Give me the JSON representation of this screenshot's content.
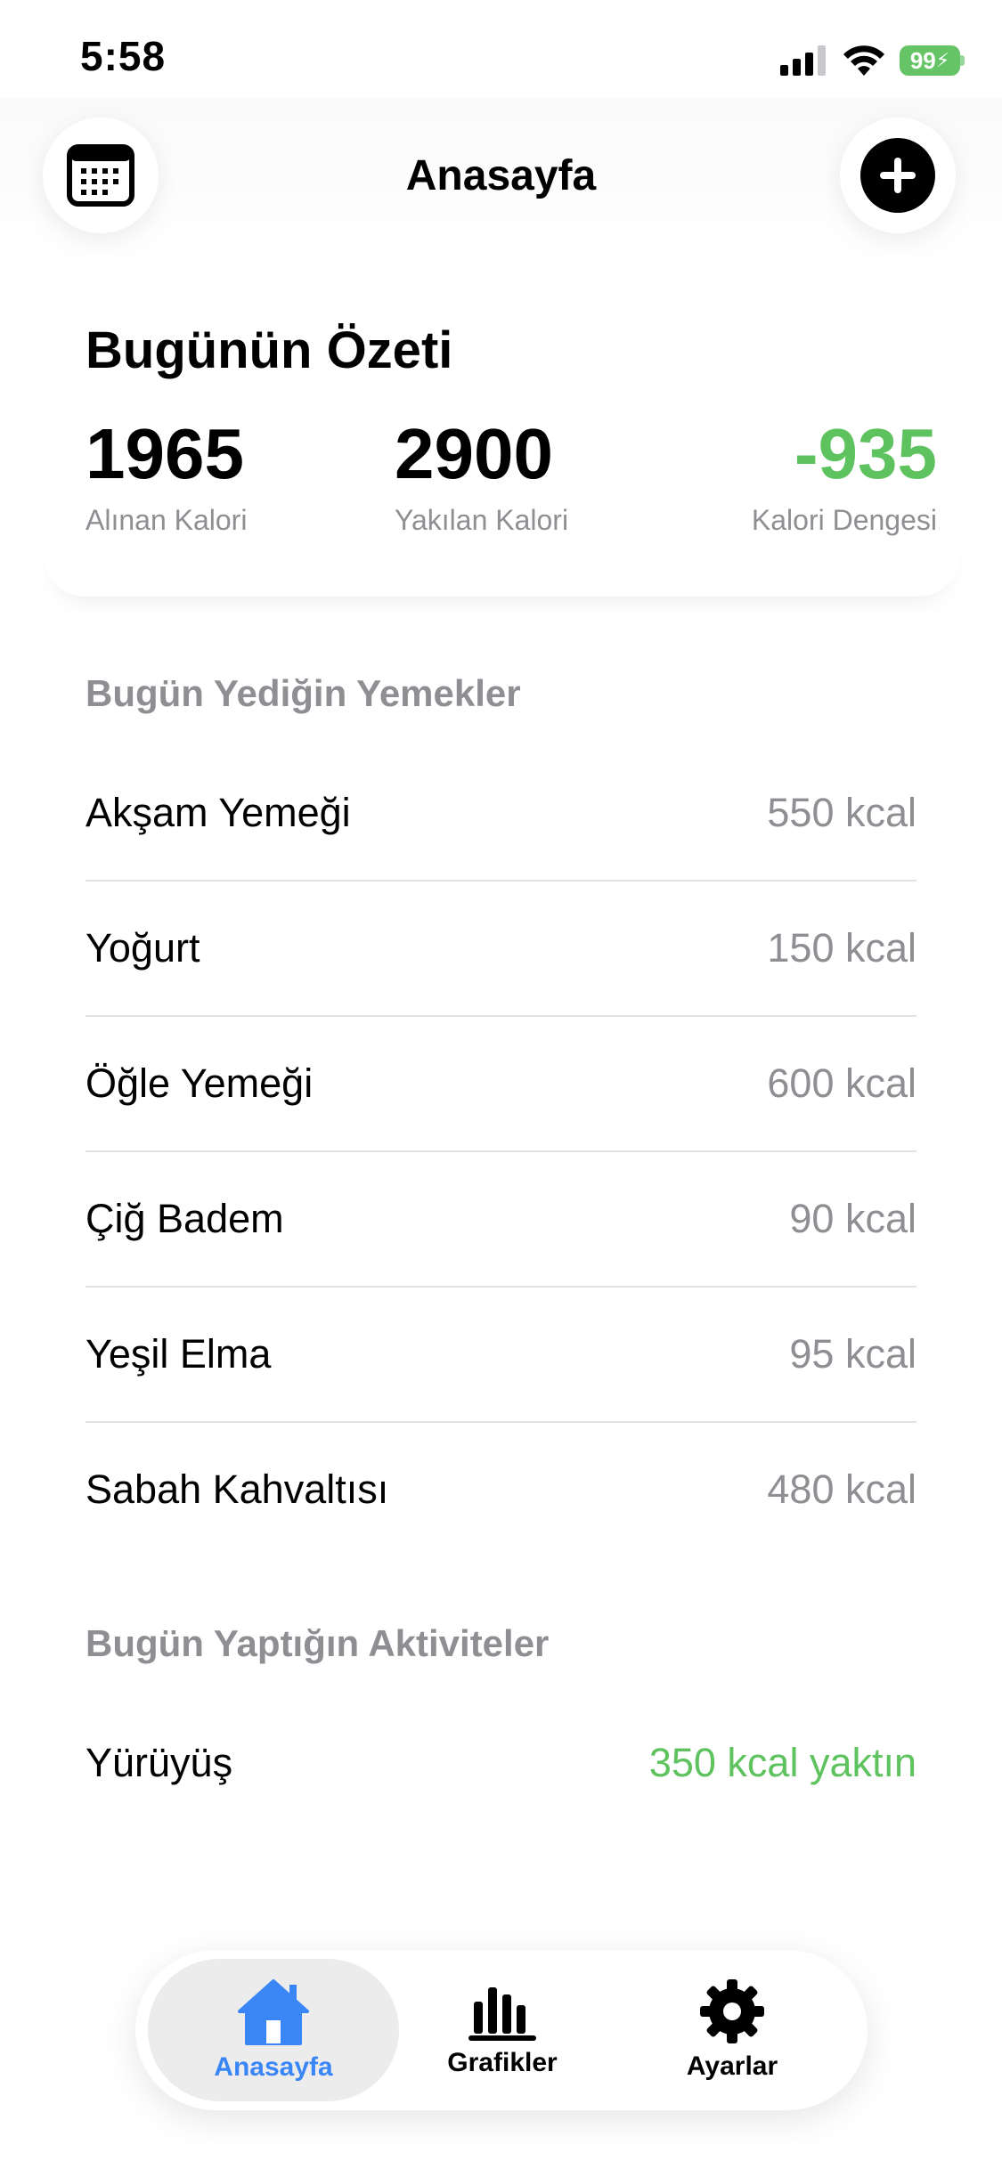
{
  "status_bar": {
    "time": "5:58",
    "battery": "99"
  },
  "header": {
    "title": "Anasayfa"
  },
  "summary": {
    "title": "Bugünün Özeti",
    "intake": {
      "value": "1965",
      "label": "Alınan Kalori"
    },
    "burned": {
      "value": "2900",
      "label": "Yakılan Kalori"
    },
    "balance": {
      "value": "-935",
      "label": "Kalori Dengesi"
    }
  },
  "foods": {
    "header": "Bugün Yediğin Yemekler",
    "items": [
      {
        "name": "Akşam Yemeği",
        "kcal": "550 kcal"
      },
      {
        "name": "Yoğurt",
        "kcal": "150 kcal"
      },
      {
        "name": "Öğle Yemeği",
        "kcal": "600 kcal"
      },
      {
        "name": "Çiğ Badem",
        "kcal": "90 kcal"
      },
      {
        "name": "Yeşil Elma",
        "kcal": "95 kcal"
      },
      {
        "name": "Sabah Kahvaltısı",
        "kcal": "480 kcal"
      }
    ]
  },
  "activities": {
    "header": "Bugün Yaptığın Aktiviteler",
    "items": [
      {
        "name": "Yürüyüş",
        "kcal": "350 kcal yaktın"
      }
    ]
  },
  "tabs": [
    {
      "label": "Anasayfa",
      "icon": "house-icon",
      "active": true
    },
    {
      "label": "Grafikler",
      "icon": "bar-chart-icon",
      "active": false
    },
    {
      "label": "Ayarlar",
      "icon": "gear-icon",
      "active": false
    }
  ],
  "colors": {
    "accent": "#3a86f7",
    "positive": "#5ec35f",
    "secondary_text": "#8e8e93"
  }
}
